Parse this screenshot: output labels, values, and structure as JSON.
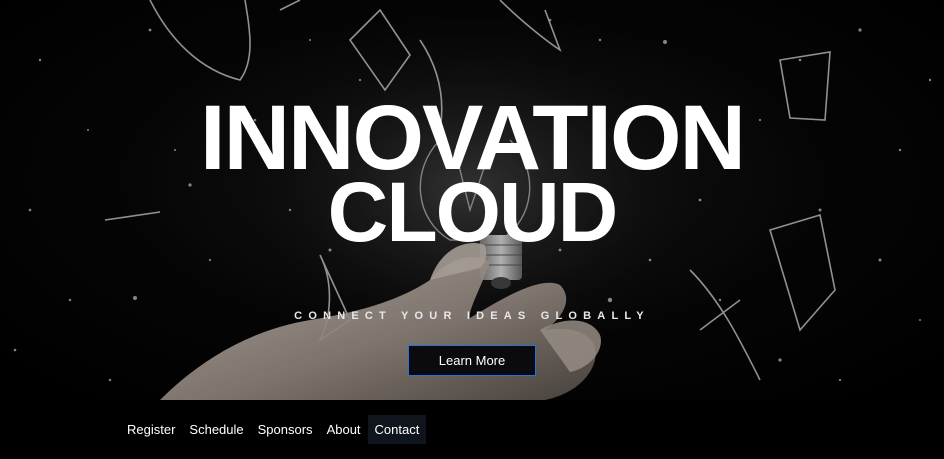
{
  "hero": {
    "title_line_1": "INNOVATION",
    "title_line_2": "CLOUD",
    "tagline": "CONNECT YOUR IDEAS GLOBALLY",
    "cta_label": "Learn More",
    "background_image": "shattering-light-bulb-in-hand"
  },
  "nav": {
    "items": [
      {
        "label": "Register"
      },
      {
        "label": "Schedule"
      },
      {
        "label": "Sponsors"
      },
      {
        "label": "About"
      },
      {
        "label": "Contact",
        "active": true
      }
    ]
  },
  "colors": {
    "background": "#000000",
    "text": "#ffffff",
    "button_border": "#2f6fd6",
    "active_nav_bg": "#10141d"
  }
}
